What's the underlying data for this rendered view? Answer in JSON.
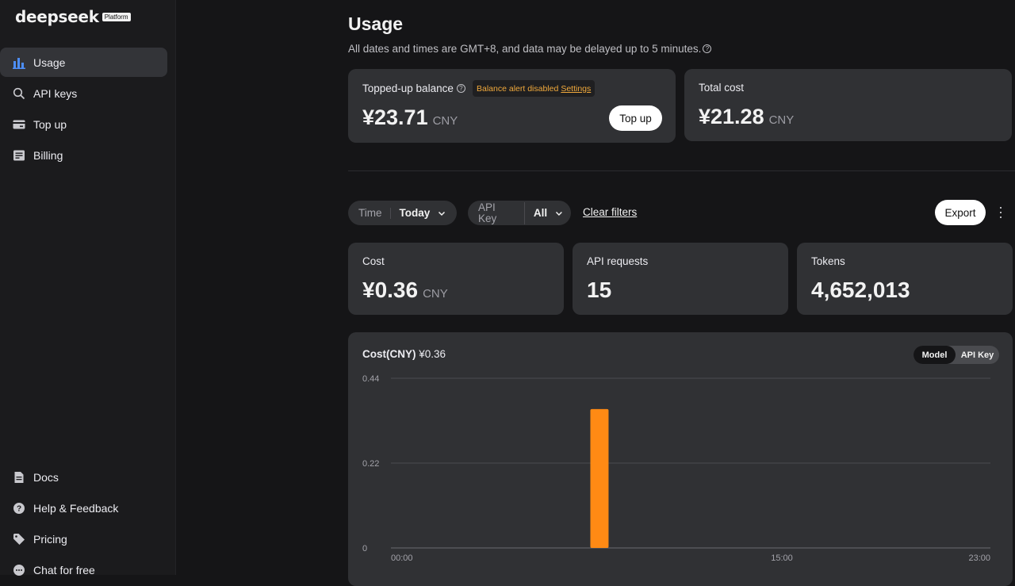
{
  "brand": {
    "name": "deepseek",
    "badge": "Platform"
  },
  "sidebar": {
    "items": [
      {
        "label": "Usage",
        "icon": "bar-chart-icon",
        "active": true
      },
      {
        "label": "API keys",
        "icon": "search-icon"
      },
      {
        "label": "Top up",
        "icon": "card-icon"
      },
      {
        "label": "Billing",
        "icon": "billing-icon"
      }
    ],
    "footer": [
      {
        "label": "Docs",
        "icon": "doc-icon"
      },
      {
        "label": "Help & Feedback",
        "icon": "help-icon"
      },
      {
        "label": "Pricing",
        "icon": "tag-icon"
      },
      {
        "label": "Chat for free",
        "icon": "chat-icon"
      }
    ]
  },
  "page": {
    "title": "Usage",
    "note": "All dates and times are GMT+8, and data may be delayed up to 5 minutes."
  },
  "balance": {
    "label": "Topped-up balance",
    "alert_text": "Balance alert disabled",
    "alert_link": "Settings",
    "value": "¥23.71",
    "unit": "CNY",
    "topup_label": "Top up"
  },
  "total_cost": {
    "label": "Total cost",
    "value": "¥21.28",
    "unit": "CNY"
  },
  "filters": {
    "time_key": "Time",
    "time_value": "Today",
    "apikey_key": "API Key",
    "apikey_value": "All",
    "clear_label": "Clear filters",
    "export_label": "Export"
  },
  "stats": {
    "cost": {
      "label": "Cost",
      "value": "¥0.36",
      "unit": "CNY"
    },
    "requests": {
      "label": "API requests",
      "value": "15"
    },
    "tokens": {
      "label": "Tokens",
      "value": "4,652,013"
    }
  },
  "chart": {
    "title": "Cost(CNY)",
    "total": "¥0.36",
    "toggle": {
      "model": "Model",
      "apikey": "API Key",
      "selected": "Model"
    }
  },
  "colors": {
    "accent": "#ff8a14",
    "active_nav": "#333438",
    "card": "#303134"
  },
  "chart_data": {
    "type": "bar",
    "title": "Cost(CNY)",
    "x_ticks": [
      "00:00",
      "15:00",
      "23:00"
    ],
    "y_ticks": [
      0,
      0.22,
      0.44
    ],
    "ylim": [
      0,
      0.44
    ],
    "x_range_hours": [
      0,
      23
    ],
    "bars": [
      {
        "hour": 8,
        "value": 0.36
      }
    ],
    "grid": true,
    "legend": "none"
  }
}
